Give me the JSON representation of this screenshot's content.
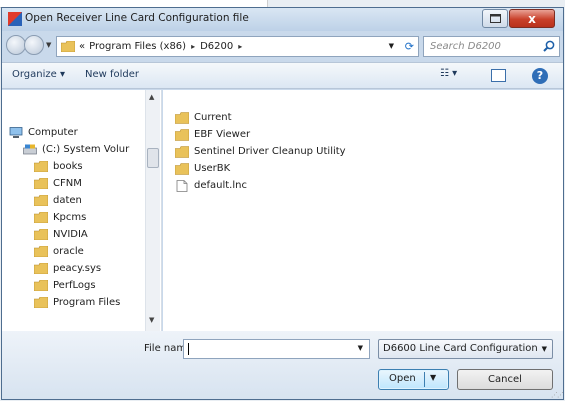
{
  "window": {
    "title": "Open Receiver Line Card Configuration file",
    "close_glyph": "x"
  },
  "address": {
    "overflow": "«",
    "crumbs": [
      "Program Files (x86)",
      "D6200"
    ],
    "separator": "▸",
    "search_placeholder": "Search D6200"
  },
  "toolbar": {
    "organize": "Organize ▾",
    "new_folder": "New folder",
    "views_glyph": "☷ ▾",
    "help_glyph": "?"
  },
  "nav_tree": [
    {
      "label": "Computer",
      "icon": "computer-icon"
    },
    {
      "label": "(C:) System Volur",
      "icon": "drive-icon"
    },
    {
      "label": "books",
      "icon": "folder-icon"
    },
    {
      "label": "CFNM",
      "icon": "folder-icon"
    },
    {
      "label": "daten",
      "icon": "folder-icon"
    },
    {
      "label": "Kpcms",
      "icon": "folder-icon"
    },
    {
      "label": "NVIDIA",
      "icon": "folder-icon"
    },
    {
      "label": "oracle",
      "icon": "folder-icon"
    },
    {
      "label": "peacy.sys",
      "icon": "folder-icon"
    },
    {
      "label": "PerfLogs",
      "icon": "folder-icon"
    },
    {
      "label": "Program Files",
      "icon": "folder-icon"
    }
  ],
  "files": [
    {
      "label": "Current",
      "icon": "folder-icon"
    },
    {
      "label": "EBF Viewer",
      "icon": "folder-icon"
    },
    {
      "label": "Sentinel Driver Cleanup Utility",
      "icon": "folder-icon"
    },
    {
      "label": "UserBK",
      "icon": "folder-icon"
    },
    {
      "label": "default.lnc",
      "icon": "file-icon"
    }
  ],
  "footer": {
    "file_name_label": "File name:",
    "file_name_value": "",
    "file_type": "D6600 Line Card Configuration",
    "open_label": "Open",
    "cancel_label": "Cancel"
  },
  "colors": {
    "folder": "#e9c25a",
    "accent": "#2f6eb7",
    "close": "#c9402a"
  }
}
